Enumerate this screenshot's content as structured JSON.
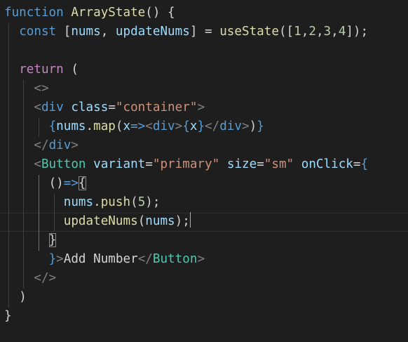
{
  "editor": {
    "language": "jsx",
    "theme": "dark",
    "cursor_line": 12,
    "lines": [
      [
        {
          "t": "function",
          "c": "k"
        },
        {
          "t": " ",
          "c": "p"
        },
        {
          "t": "ArrayState",
          "c": "fn"
        },
        {
          "t": "() {",
          "c": "p"
        }
      ],
      [
        {
          "t": "  ",
          "c": "p"
        },
        {
          "t": "const",
          "c": "k"
        },
        {
          "t": " [",
          "c": "p"
        },
        {
          "t": "nums",
          "c": "v"
        },
        {
          "t": ", ",
          "c": "p"
        },
        {
          "t": "updateNums",
          "c": "v"
        },
        {
          "t": "] = ",
          "c": "p"
        },
        {
          "t": "useState",
          "c": "fn"
        },
        {
          "t": "([",
          "c": "p"
        },
        {
          "t": "1",
          "c": "n"
        },
        {
          "t": ",",
          "c": "p"
        },
        {
          "t": "2",
          "c": "n"
        },
        {
          "t": ",",
          "c": "p"
        },
        {
          "t": "3",
          "c": "n"
        },
        {
          "t": ",",
          "c": "p"
        },
        {
          "t": "4",
          "c": "n"
        },
        {
          "t": "]);",
          "c": "p"
        }
      ],
      [],
      [
        {
          "t": "  ",
          "c": "p"
        },
        {
          "t": "return",
          "c": "ctrl"
        },
        {
          "t": " (",
          "c": "p"
        }
      ],
      [
        {
          "t": "    ",
          "c": "p"
        },
        {
          "t": "<>",
          "c": "tg"
        }
      ],
      [
        {
          "t": "    ",
          "c": "p"
        },
        {
          "t": "<",
          "c": "tg"
        },
        {
          "t": "div",
          "c": "tn"
        },
        {
          "t": " ",
          "c": "p"
        },
        {
          "t": "class",
          "c": "at"
        },
        {
          "t": "=",
          "c": "p"
        },
        {
          "t": "\"container\"",
          "c": "s"
        },
        {
          "t": ">",
          "c": "tg"
        }
      ],
      [
        {
          "t": "      ",
          "c": "p"
        },
        {
          "t": "{",
          "c": "k"
        },
        {
          "t": "nums",
          "c": "v"
        },
        {
          "t": ".",
          "c": "p"
        },
        {
          "t": "map",
          "c": "fn"
        },
        {
          "t": "(",
          "c": "p"
        },
        {
          "t": "x",
          "c": "v"
        },
        {
          "t": "=>",
          "c": "k"
        },
        {
          "t": "<",
          "c": "tg"
        },
        {
          "t": "div",
          "c": "tn"
        },
        {
          "t": ">",
          "c": "tg"
        },
        {
          "t": "{",
          "c": "k"
        },
        {
          "t": "x",
          "c": "v"
        },
        {
          "t": "}",
          "c": "k"
        },
        {
          "t": "</",
          "c": "tg"
        },
        {
          "t": "div",
          "c": "tn"
        },
        {
          "t": ">",
          "c": "tg"
        },
        {
          "t": ")",
          "c": "p"
        },
        {
          "t": "}",
          "c": "k"
        }
      ],
      [
        {
          "t": "    ",
          "c": "p"
        },
        {
          "t": "</",
          "c": "tg"
        },
        {
          "t": "div",
          "c": "tn"
        },
        {
          "t": ">",
          "c": "tg"
        }
      ],
      [
        {
          "t": "    ",
          "c": "p"
        },
        {
          "t": "<",
          "c": "tg"
        },
        {
          "t": "Button",
          "c": "jsx"
        },
        {
          "t": " ",
          "c": "p"
        },
        {
          "t": "variant",
          "c": "at"
        },
        {
          "t": "=",
          "c": "p"
        },
        {
          "t": "\"primary\"",
          "c": "s"
        },
        {
          "t": " ",
          "c": "p"
        },
        {
          "t": "size",
          "c": "at"
        },
        {
          "t": "=",
          "c": "p"
        },
        {
          "t": "\"sm\"",
          "c": "s"
        },
        {
          "t": " ",
          "c": "p"
        },
        {
          "t": "onClick",
          "c": "at"
        },
        {
          "t": "=",
          "c": "p"
        },
        {
          "t": "{",
          "c": "k"
        }
      ],
      [
        {
          "t": "      ",
          "c": "p"
        },
        {
          "t": "()",
          "c": "p"
        },
        {
          "t": "=>",
          "c": "k"
        },
        {
          "t": "{",
          "c": "p",
          "m": true
        }
      ],
      [
        {
          "t": "        ",
          "c": "p"
        },
        {
          "t": "nums",
          "c": "v"
        },
        {
          "t": ".",
          "c": "p"
        },
        {
          "t": "push",
          "c": "fn"
        },
        {
          "t": "(",
          "c": "p"
        },
        {
          "t": "5",
          "c": "n"
        },
        {
          "t": ");",
          "c": "p"
        }
      ],
      [
        {
          "t": "        ",
          "c": "p"
        },
        {
          "t": "updateNums",
          "c": "fn"
        },
        {
          "t": "(",
          "c": "p"
        },
        {
          "t": "nums",
          "c": "v"
        },
        {
          "t": ");",
          "c": "p"
        }
      ],
      [
        {
          "t": "      ",
          "c": "p"
        },
        {
          "t": "}",
          "c": "p",
          "m": true
        }
      ],
      [
        {
          "t": "      ",
          "c": "p"
        },
        {
          "t": "}",
          "c": "k"
        },
        {
          "t": ">",
          "c": "tg"
        },
        {
          "t": "Add Number",
          "c": "tx"
        },
        {
          "t": "</",
          "c": "tg"
        },
        {
          "t": "Button",
          "c": "jsx"
        },
        {
          "t": ">",
          "c": "tg"
        }
      ],
      [
        {
          "t": "    ",
          "c": "p"
        },
        {
          "t": "</>",
          "c": "tg"
        }
      ],
      [
        {
          "t": "  ",
          "c": "p"
        },
        {
          "t": ")",
          "c": "p"
        }
      ],
      [
        {
          "t": "}",
          "c": "p"
        }
      ]
    ]
  },
  "colors": {
    "background": "#1e1e1e",
    "keyword": "#569cd6",
    "function": "#dcdcaa",
    "variable": "#9cdcfe",
    "string": "#ce9178",
    "number": "#b5cea8",
    "control": "#c586c0",
    "tag_punctuation": "#808080",
    "component": "#4ec9b0",
    "plain": "#d4d4d4"
  }
}
